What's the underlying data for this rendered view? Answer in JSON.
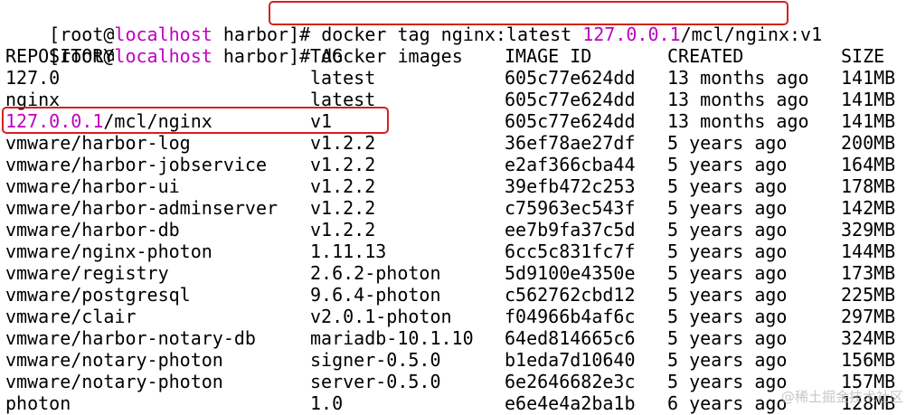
{
  "prompt1": {
    "prefix": "[root@",
    "host": "localhost",
    "suffix": " harbor]#",
    "cmd_a": "docker tag nginx:latest ",
    "cmd_ip": "127.0.0.1",
    "cmd_b": "/mcl/nginx:v1"
  },
  "prompt2": {
    "prefix": "[root@",
    "host": "localhost",
    "suffix": " harbor]#",
    "command": " docker images"
  },
  "headers": {
    "repository": "REPOSITORY",
    "tag": "TAG",
    "image_id": "IMAGE ID",
    "created": "CREATED",
    "size": "SIZE"
  },
  "highlighted_row": {
    "repo_ip": "127.0.0.1",
    "repo_rest": "/mcl/nginx",
    "tag": "v1",
    "image_id": "605c77e624dd",
    "created": "13 months ago",
    "size": "141MB"
  },
  "rows_before": [
    {
      "repository": "127.0",
      "tag": "latest",
      "image_id": "605c77e624dd",
      "created": "13 months ago",
      "size": "141MB"
    },
    {
      "repository": "nginx",
      "tag": "latest",
      "image_id": "605c77e624dd",
      "created": "13 months ago",
      "size": "141MB"
    }
  ],
  "rows_after": [
    {
      "repository": "vmware/harbor-log",
      "tag": "v1.2.2",
      "image_id": "36ef78ae27df",
      "created": "5 years ago",
      "size": "200MB"
    },
    {
      "repository": "vmware/harbor-jobservice",
      "tag": "v1.2.2",
      "image_id": "e2af366cba44",
      "created": "5 years ago",
      "size": "164MB"
    },
    {
      "repository": "vmware/harbor-ui",
      "tag": "v1.2.2",
      "image_id": "39efb472c253",
      "created": "5 years ago",
      "size": "178MB"
    },
    {
      "repository": "vmware/harbor-adminserver",
      "tag": "v1.2.2",
      "image_id": "c75963ec543f",
      "created": "5 years ago",
      "size": "142MB"
    },
    {
      "repository": "vmware/harbor-db",
      "tag": "v1.2.2",
      "image_id": "ee7b9fa37c5d",
      "created": "5 years ago",
      "size": "329MB"
    },
    {
      "repository": "vmware/nginx-photon",
      "tag": "1.11.13",
      "image_id": "6cc5c831fc7f",
      "created": "5 years ago",
      "size": "144MB"
    },
    {
      "repository": "vmware/registry",
      "tag": "2.6.2-photon",
      "image_id": "5d9100e4350e",
      "created": "5 years ago",
      "size": "173MB"
    },
    {
      "repository": "vmware/postgresql",
      "tag": "9.6.4-photon",
      "image_id": "c562762cbd12",
      "created": "5 years ago",
      "size": "225MB"
    },
    {
      "repository": "vmware/clair",
      "tag": "v2.0.1-photon",
      "image_id": "f04966b4af6c",
      "created": "5 years ago",
      "size": "297MB"
    },
    {
      "repository": "vmware/harbor-notary-db",
      "tag": "mariadb-10.1.10",
      "image_id": "64ed814665c6",
      "created": "5 years ago",
      "size": "324MB"
    },
    {
      "repository": "vmware/notary-photon",
      "tag": "signer-0.5.0",
      "image_id": "b1eda7d10640",
      "created": "5 years ago",
      "size": "156MB"
    },
    {
      "repository": "vmware/notary-photon",
      "tag": "server-0.5.0",
      "image_id": "6e2646682e3c",
      "created": "5 years ago",
      "size": "157MB"
    },
    {
      "repository": "photon",
      "tag": "1.0",
      "image_id": "e6e4e4a2ba1b",
      "created": "6 years ago",
      "size": "128MB"
    }
  ],
  "watermark": "@稀土掘金技术社区",
  "colors": {
    "hostname": "#c000c0",
    "highlight_border": "#d62020",
    "background": "#ffffff",
    "text": "#000000"
  }
}
